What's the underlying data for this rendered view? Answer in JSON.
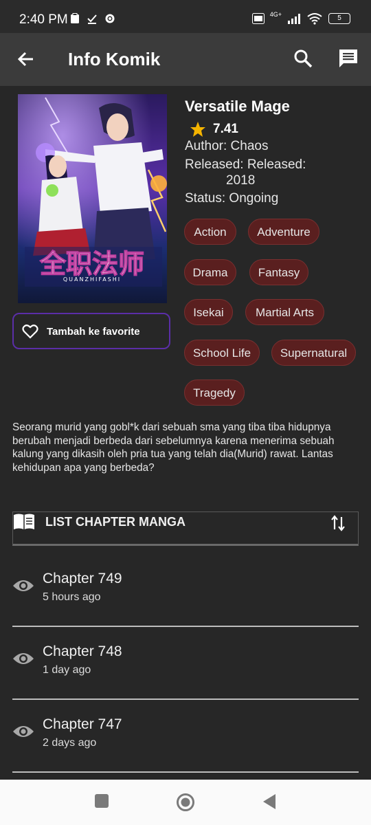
{
  "status_bar": {
    "time": "2:40 PM",
    "battery": "5",
    "network": "4G+"
  },
  "app_bar": {
    "title": "Info Komik",
    "icons": [
      "back-arrow-icon",
      "search-icon",
      "comment-icon"
    ]
  },
  "cover": {
    "title_art": "全职法师",
    "subtitle_art": "QUANZHIFASHI"
  },
  "favorite": {
    "label": "Tambah ke favorite"
  },
  "comic": {
    "title": "Versatile Mage",
    "rating": "7.41",
    "author": "Author: Chaos",
    "released": "Released: Released:",
    "released_year": "2018",
    "status": "Status: Ongoing",
    "genres": [
      "Action",
      "Adventure",
      "Drama",
      "Fantasy",
      "Isekai",
      "Martial Arts",
      "School Life",
      "Supernatural",
      "Tragedy"
    ],
    "synopsis": "Seorang murid yang gobl*k dari sebuah sma yang tiba tiba hidupnya berubah menjadi berbeda dari sebelumnya karena menerima sebuah kalung yang dikasih oleh pria tua yang telah dia(Murid) rawat. Lantas kehidupan apa yang berbeda?"
  },
  "chapter_list": {
    "header": "LIST CHAPTER MANGA",
    "chapters": [
      {
        "name": "Chapter 749",
        "time": "5 hours ago"
      },
      {
        "name": "Chapter 748",
        "time": "1 day ago"
      },
      {
        "name": "Chapter 747",
        "time": "2 days ago"
      }
    ]
  },
  "colors": {
    "background": "#272727",
    "app_bar": "#3b3b3b",
    "tag_bg": "#5a1f1f",
    "tag_border": "#7a3030",
    "fav_border": "#5b2ea8",
    "rating_star": "#f5b400"
  }
}
